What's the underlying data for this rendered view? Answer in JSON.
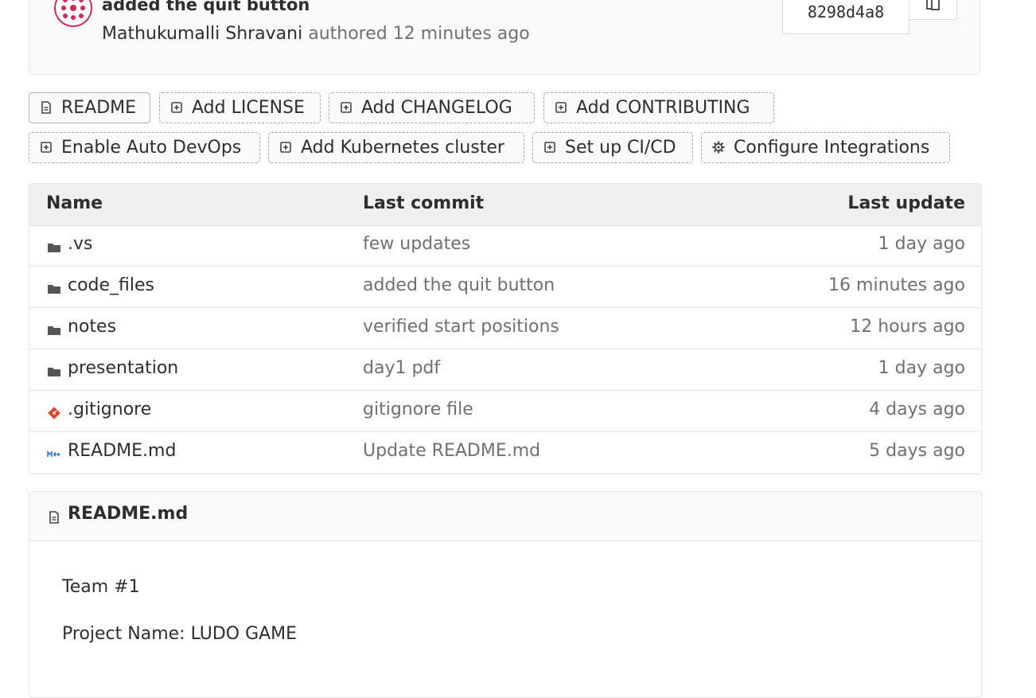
{
  "commit": {
    "title": "added the quit button",
    "author": "Mathukumalli Shravani",
    "authored_label": "authored",
    "time": "12 minutes ago",
    "sha": "8298d4a8"
  },
  "actions": [
    {
      "label": "README",
      "icon": "file-icon"
    },
    {
      "label": "Add LICENSE",
      "icon": "plus-square-icon"
    },
    {
      "label": "Add CHANGELOG",
      "icon": "plus-square-icon"
    },
    {
      "label": "Add CONTRIBUTING",
      "icon": "plus-square-icon"
    },
    {
      "label": "Enable Auto DevOps",
      "icon": "plus-square-icon"
    },
    {
      "label": "Add Kubernetes cluster",
      "icon": "plus-square-icon"
    },
    {
      "label": "Set up CI/CD",
      "icon": "plus-square-icon"
    },
    {
      "label": "Configure Integrations",
      "icon": "gear-icon"
    }
  ],
  "table": {
    "headers": {
      "name": "Name",
      "last_commit": "Last commit",
      "last_update": "Last update"
    },
    "rows": [
      {
        "name": ".vs",
        "icon": "folder-icon",
        "commit": "few updates",
        "date": "1 day ago"
      },
      {
        "name": "code_files",
        "icon": "folder-icon",
        "commit": "added the quit button",
        "date": "16 minutes ago"
      },
      {
        "name": "notes",
        "icon": "folder-icon",
        "commit": "verified start positions",
        "date": "12 hours ago"
      },
      {
        "name": "presentation",
        "icon": "folder-icon",
        "commit": "day1 pdf",
        "date": "1 day ago"
      },
      {
        "name": ".gitignore",
        "icon": "git-icon",
        "commit": "gitignore file",
        "date": "4 days ago"
      },
      {
        "name": "README.md",
        "icon": "markdown-icon",
        "commit": "Update README.md",
        "date": "5 days ago"
      }
    ]
  },
  "readme": {
    "title": "README.md",
    "lines": [
      "Team #1",
      "Project Name: LUDO GAME"
    ]
  },
  "colors": {
    "git_orange": "#e24329",
    "markdown_blue": "#1f78d1",
    "avatar_red": "#d22852"
  }
}
